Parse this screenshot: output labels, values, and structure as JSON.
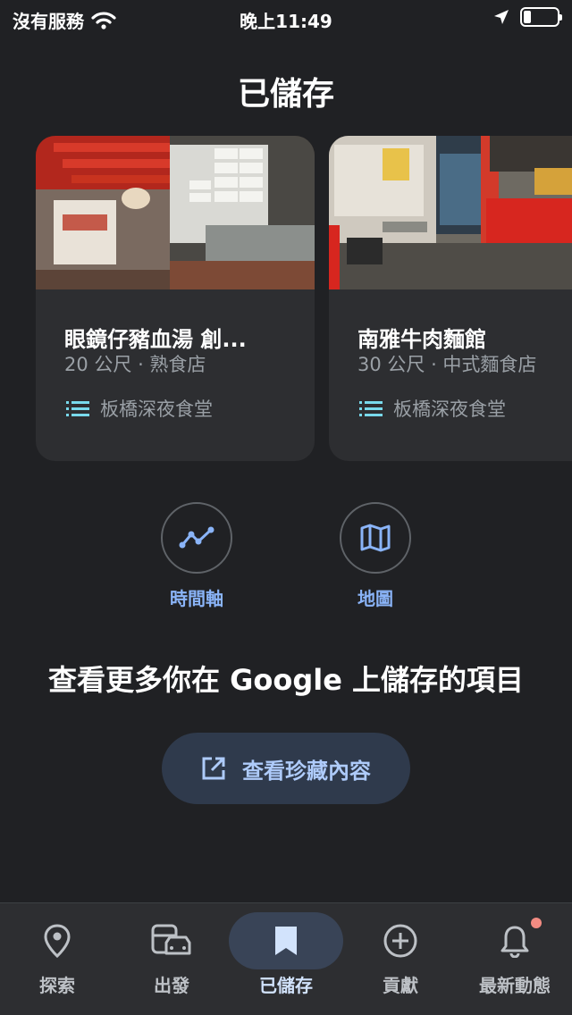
{
  "status_bar": {
    "carrier": "沒有服務",
    "time": "晚上11:49"
  },
  "page": {
    "title": "已儲存"
  },
  "cards": [
    {
      "name": "眼鏡仔豬血湯 創...",
      "subtitle": "20 公尺 · 熟食店",
      "list": "板橋深夜食堂"
    },
    {
      "name": "南雅牛肉麵館",
      "subtitle": "30 公尺 · 中式麵食店",
      "list": "板橋深夜食堂"
    }
  ],
  "actions": {
    "timeline": "時間軸",
    "map": "地圖"
  },
  "promo": {
    "text": "查看更多你在 Google 上儲存的項目",
    "button_label": "查看珍藏內容"
  },
  "bottom_nav": [
    {
      "label": "探索",
      "icon": "location-pin-icon"
    },
    {
      "label": "出發",
      "icon": "car-transit-icon"
    },
    {
      "label": "已儲存",
      "icon": "bookmark-icon",
      "active": true
    },
    {
      "label": "貢獻",
      "icon": "plus-circle-icon"
    },
    {
      "label": "最新動態",
      "icon": "bell-icon",
      "badge": true
    }
  ],
  "colors": {
    "background": "#202124",
    "card": "#2d2e31",
    "accent": "#8ab4f8",
    "badge": "#f28b82"
  }
}
